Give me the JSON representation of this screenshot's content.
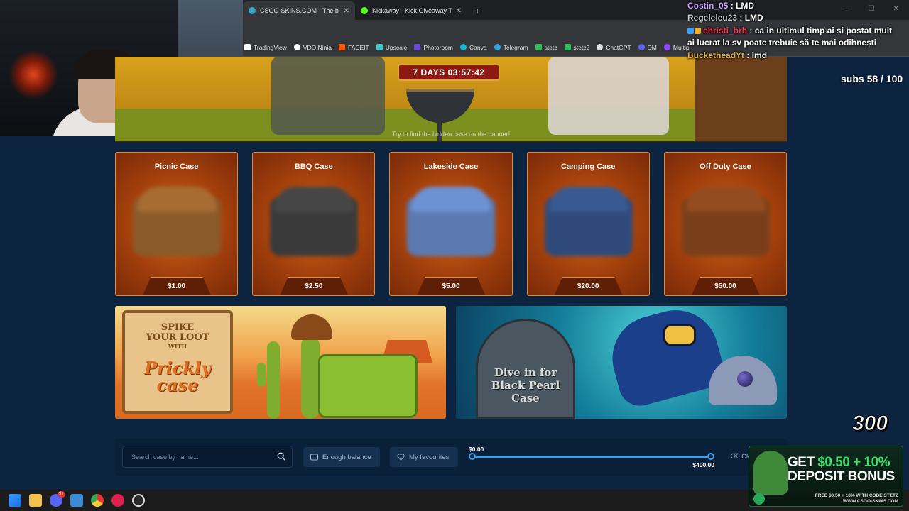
{
  "browser": {
    "tabs": [
      {
        "title": "CSGO-SKINS.COM - The best C",
        "favicon_color": "#3aa6c8",
        "active": true
      },
      {
        "title": "Kickaway - Kick Giveaway Tool",
        "favicon_color": "#53fc18",
        "active": false
      }
    ],
    "bookmarks": [
      {
        "label": "TradingView",
        "color": "#ffffff"
      },
      {
        "label": "VDO.Ninja",
        "color": "#ffffff"
      },
      {
        "label": "FACEIT",
        "color": "#ff5500"
      },
      {
        "label": "Upscale",
        "color": "#3ec8d0"
      },
      {
        "label": "Photoroom",
        "color": "#6a4cd6"
      },
      {
        "label": "Canva",
        "color": "#17b7cf"
      },
      {
        "label": "Telegram",
        "color": "#2aa3e0"
      },
      {
        "label": "stetz",
        "color": "#2fbf5a"
      },
      {
        "label": "stetz2",
        "color": "#2fbf5a"
      },
      {
        "label": "ChatGPT",
        "color": "#e0e0e0"
      },
      {
        "label": "DM",
        "color": "#5865f2"
      },
      {
        "label": "Multip",
        "color": "#9146ff"
      }
    ]
  },
  "chat": {
    "messages": [
      {
        "user": "Costin_05",
        "text": "LMD",
        "user_color": "#c8a0ff"
      },
      {
        "user": "Regeleleu23",
        "text": "LMD",
        "user_color": "#c8c8c8"
      },
      {
        "user": "christi_brb",
        "text": "ca în ultimul timp ai și postat mult ai lucrat la sv poate trebuie să te mai odihnești",
        "user_color": "#ff3050"
      },
      {
        "user": "BucketheadYt",
        "text": "lmd",
        "user_color": "#e0b050"
      }
    ],
    "subs": "subs 58 / 100"
  },
  "hero": {
    "timer": "7 DAYS  03:57:42",
    "hint": "Try to find the hidden case on the banner!"
  },
  "cases": [
    {
      "name": "Picnic Case",
      "price": "$1.00",
      "color": "#8a5a2a"
    },
    {
      "name": "BBQ Case",
      "price": "$2.50",
      "color": "#3a3a3a"
    },
    {
      "name": "Lakeside Case",
      "price": "$5.00",
      "color": "#5a7ab0"
    },
    {
      "name": "Camping Case",
      "price": "$20.00",
      "color": "#2f4a7a"
    },
    {
      "name": "Off Duty Case",
      "price": "$50.00",
      "color": "#7a3f1a"
    }
  ],
  "promos": {
    "desert": {
      "line1": "SPIKE",
      "line2": "YOUR LOOT",
      "with": "WITH",
      "big1": "Prickly",
      "big2": "case"
    },
    "sea": {
      "line1": "Dive in for",
      "line2": "Black Pearl",
      "line3": "Case"
    }
  },
  "filters": {
    "search_placeholder": "Search case by name...",
    "enough_balance": "Enough balance",
    "my_favourites": "My favourites",
    "price_min": "$0.00",
    "price_max": "$400.00",
    "clear": "Cle"
  },
  "overlay": {
    "counter": "300",
    "bonus_line1_a": "GET ",
    "bonus_line1_b": "$0.50",
    "bonus_line1_c": " + 10%",
    "bonus_line2": "DEPOSIT BONUS",
    "bonus_small1": "FREE $0.50 + 10% WITH CODE STETZ",
    "bonus_small2": "WWW.CSGO-SKINS.COM"
  },
  "taskbar": {
    "discord_badge": "9+"
  }
}
